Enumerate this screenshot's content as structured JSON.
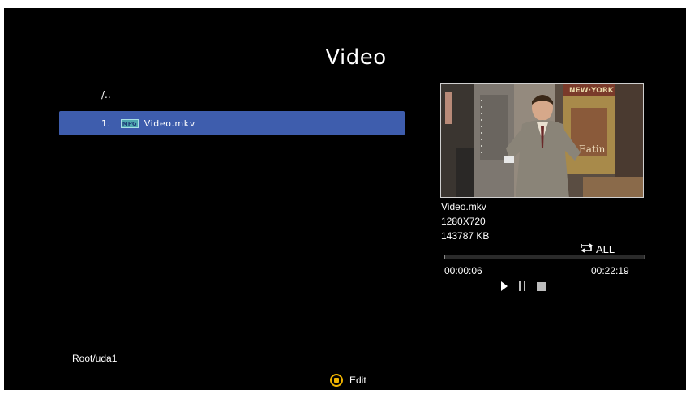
{
  "header": {
    "title": "Video"
  },
  "browser": {
    "parent_dir": "/..",
    "files": [
      {
        "index": "1.",
        "type_badge": "MPG",
        "name": "Video.mkv",
        "selected": true
      }
    ]
  },
  "info": {
    "name": "Video.mkv",
    "resolution": "1280X720",
    "size": "143787 KB"
  },
  "playback": {
    "repeat_label": "ALL",
    "elapsed": "00:00:06",
    "total": "00:22:19",
    "progress_fraction": 0.0045,
    "controls": [
      "play-icon",
      "pause-icon",
      "stop-icon"
    ]
  },
  "footer": {
    "path": "Root/uda1",
    "edit_label": "Edit"
  },
  "colors": {
    "selection": "#3e5dad",
    "edit_button": "#f0b400",
    "background": "#000000"
  }
}
